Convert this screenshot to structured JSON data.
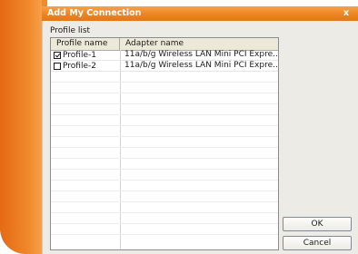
{
  "window": {
    "title": "Add My Connection",
    "close_glyph": "x"
  },
  "group_label": "Profile list",
  "table": {
    "columns": [
      "Profile name",
      "Adapter name"
    ],
    "rows": [
      {
        "checked": true,
        "profile": "Profile-1",
        "adapter": "11a/b/g Wireless LAN Mini PCI Expre.."
      },
      {
        "checked": false,
        "profile": "Profile-2",
        "adapter": "11a/b/g Wireless LAN Mini PCI Expre.."
      }
    ]
  },
  "buttons": {
    "ok": "OK",
    "cancel": "Cancel"
  },
  "colors": {
    "accent": "#ee8420",
    "dialog_bg": "#ecebe6"
  }
}
